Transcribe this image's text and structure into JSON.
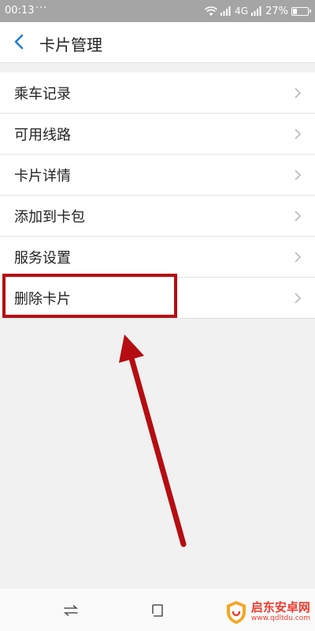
{
  "status_bar": {
    "time": "00:13",
    "dots": "···",
    "network": "4G",
    "battery_percent": "27%",
    "battery_level": 0.27
  },
  "header": {
    "title": "卡片管理",
    "back_icon": "chevron-left-icon"
  },
  "menu": {
    "items": [
      {
        "label": "乘车记录"
      },
      {
        "label": "可用线路"
      },
      {
        "label": "卡片详情"
      },
      {
        "label": "添加到卡包"
      },
      {
        "label": "服务设置"
      },
      {
        "label": "删除卡片"
      }
    ]
  },
  "watermark": {
    "name": "启东安卓网",
    "url": "www.qdltdu.com"
  },
  "colors": {
    "accent": "#1f7fd8",
    "highlight": "#b50d12",
    "status_bar": "#a5a5a5"
  }
}
